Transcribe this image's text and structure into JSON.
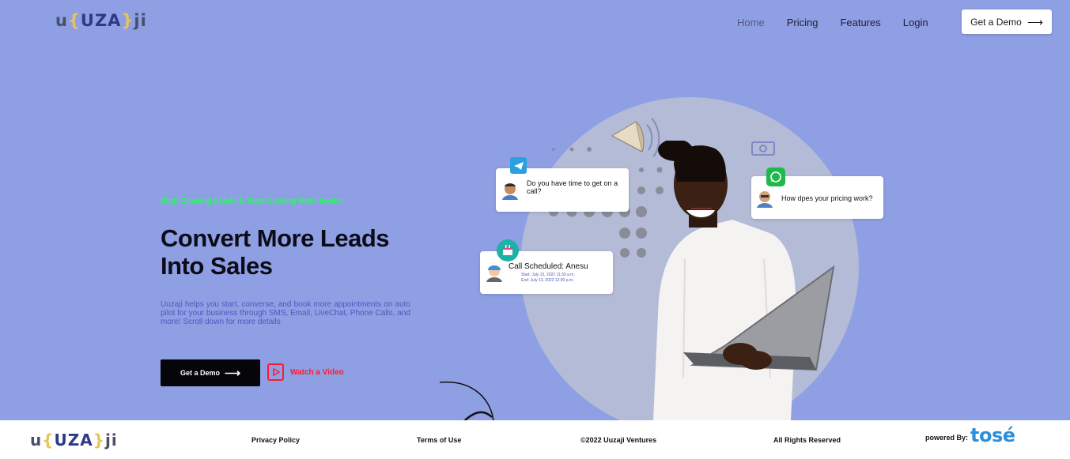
{
  "brand": {
    "u": "u",
    "open": "{",
    "uza": "UZA",
    "close": "}",
    "ji": "ji"
  },
  "nav": {
    "home": "Home",
    "pricing": "Pricing",
    "features": "Features",
    "login": "Login"
  },
  "header": {
    "demo_label": "Get a Demo",
    "arrow": "⟶"
  },
  "hero": {
    "tagline": "Stop Chasing Leads & Start Closing More Deals!",
    "headline": "Convert More Leads Into Sales",
    "description": "Uuzaji helps you start, converse, and book more appointments on auto pilot for your business through SMS, Email, LiveChat, Phone Calls, and more! Scroll down for more details",
    "demo_label": "Get a Demo",
    "arrow": "⟶",
    "watch_label": "Watch a Video"
  },
  "cards": {
    "telegram_msg": "Do you have time to get on a call?",
    "whatsapp_msg": "How dpes your pricing work?",
    "call_title": "Call Scheduled: Anesu",
    "call_start": "Start: July 13, 2022 11:30 a.m.",
    "call_end": "End: July 13, 2022 12:00 p.m."
  },
  "footer": {
    "privacy": "Privacy Policy",
    "terms": "Terms of Use",
    "copyright": "©2022 Uuzaji Ventures",
    "rights": "All Rights Reserved",
    "powered_by": "powered By:",
    "tose": "tosé"
  },
  "colors": {
    "background": "#8f9fe3",
    "tagline": "#22ff5a",
    "watch": "#ff1a2e",
    "description": "#4b59bf"
  }
}
